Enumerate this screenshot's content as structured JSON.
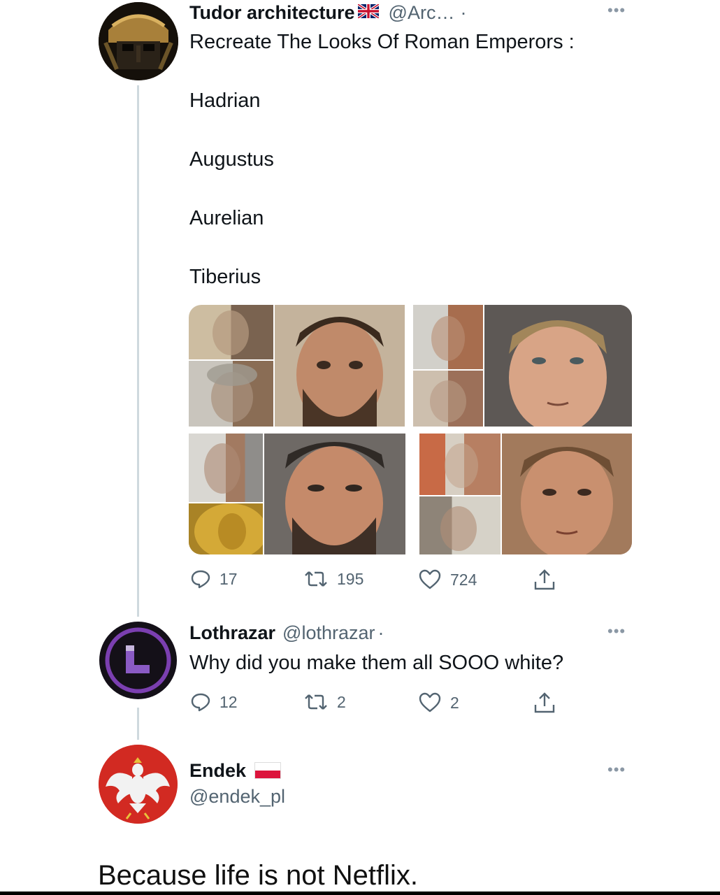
{
  "tweets": [
    {
      "name": "Tudor architecture",
      "handle": "@Arc…",
      "dot": "·",
      "text_lines": [
        "Recreate The Looks Of Roman Emperors :",
        "Hadrian",
        "Augustus",
        "Aurelian",
        "Tiberius"
      ],
      "replies": "17",
      "retweets": "195",
      "likes": "724",
      "flag": "uk-flag-icon"
    },
    {
      "name": "Lothrazar",
      "handle": "@lothrazar",
      "dot": "·",
      "text": "Why did you make them all SOOO white?",
      "replies": "12",
      "retweets": "2",
      "likes": "2"
    },
    {
      "name": "Endek",
      "handle": "@endek_pl",
      "flag": "poland-flag-icon"
    }
  ],
  "caption": "Because life is not Netflix.",
  "colors": {
    "text": "#0f1419",
    "secondary": "#536471",
    "thread_line": "#cfd9de",
    "lothrazar_avatar_ring": "#7b3fb0"
  }
}
